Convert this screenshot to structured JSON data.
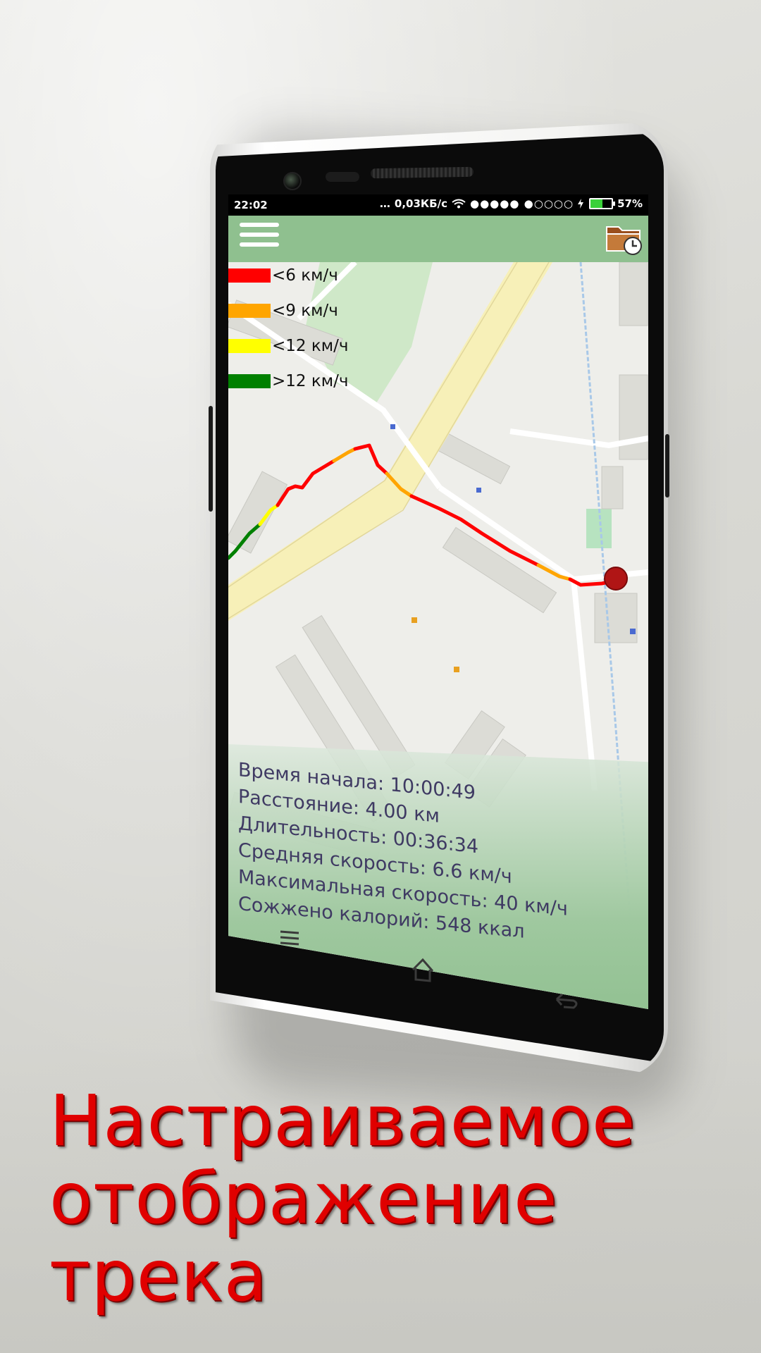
{
  "status_bar": {
    "time": "22:02",
    "network_speed": "0,03КБ/с",
    "signal": "●●●●● ●○○○○",
    "battery_percent": "57%",
    "battery_level": 0.57
  },
  "app_bar": {
    "menu_icon": "hamburger-menu-icon",
    "history_icon": "folder-clock-icon"
  },
  "legend": {
    "items": [
      {
        "label": "<6 км/ч",
        "color": "#ff0000"
      },
      {
        "label": "<9 км/ч",
        "color": "#ffa500"
      },
      {
        "label": "<12 км/ч",
        "color": "#ffff00"
      },
      {
        "label": ">12 км/ч",
        "color": "#008000"
      }
    ]
  },
  "stats": {
    "start_time": "Время начала: 10:00:49",
    "distance": "Расстояние: 4.00 км",
    "duration": "Длительность: 00:36:34",
    "avg_speed": "Средняя скорость: 6.6 км/ч",
    "max_speed": "Максимальная скорость: 40 км/ч",
    "calories": "Сожжено калорий: 548 ккал"
  },
  "colors": {
    "app_bar": "#8fc08f",
    "stats_text": "#3f3a63",
    "headline": "#e00000"
  },
  "headline": {
    "line1": "Настраиваемое",
    "line2": "отображение",
    "line3": "трека"
  }
}
